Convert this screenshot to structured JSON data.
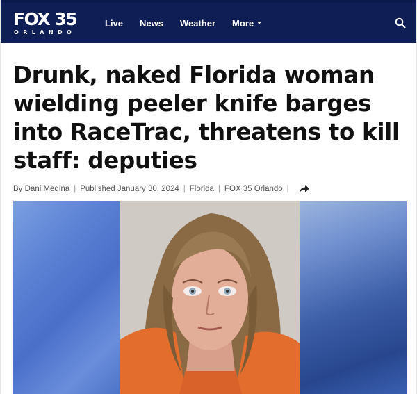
{
  "site": {
    "logo_main": "FOX 35",
    "logo_sub": "ORLANDO"
  },
  "nav": {
    "items": [
      {
        "label": "Live"
      },
      {
        "label": "News"
      },
      {
        "label": "Weather"
      },
      {
        "label": "More"
      }
    ],
    "search_icon": "search-icon"
  },
  "article": {
    "headline": "Drunk, naked Florida woman wielding peeler knife barges into RaceTrac, threatens to kill staff: deputies",
    "byline": {
      "author": "By Dani Medina",
      "published": "Published January 30, 2024",
      "category": "Florida",
      "source": "FOX 35 Orlando",
      "share_icon": "share-arrow-icon"
    }
  },
  "colors": {
    "nav_bg": "#0f1e54",
    "headline": "#111111",
    "byline": "#555555"
  }
}
